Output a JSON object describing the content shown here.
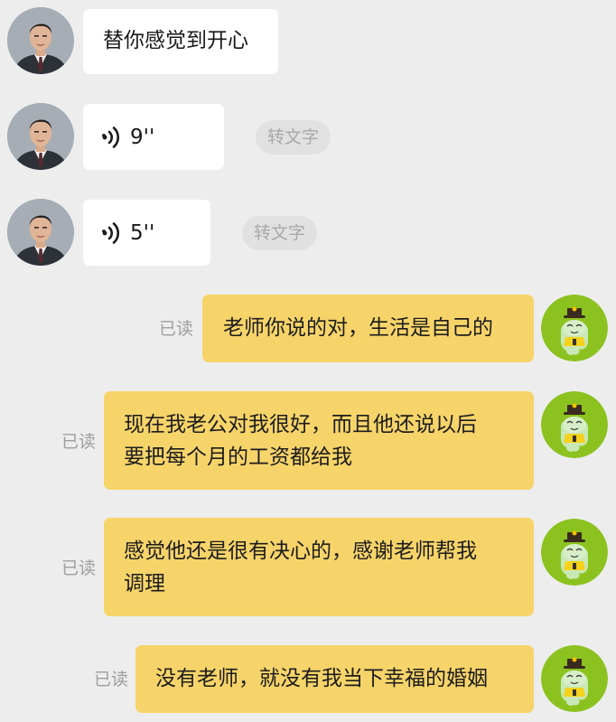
{
  "messages": [
    {
      "from": "them",
      "type": "text",
      "text": "替你感觉到开心"
    },
    {
      "from": "them",
      "type": "voice",
      "duration": "9''",
      "transcribe_label": "转文字"
    },
    {
      "from": "them",
      "type": "voice",
      "duration": "5''",
      "transcribe_label": "转文字"
    },
    {
      "from": "me",
      "type": "text",
      "status": "已读",
      "lines": [
        "老师你说的对，生活是自己的"
      ]
    },
    {
      "from": "me",
      "type": "text",
      "status": "已读",
      "lines": [
        "现在我老公对我很好，而且他还说以后",
        "要把每个月的工资都给我"
      ]
    },
    {
      "from": "me",
      "type": "text",
      "status": "已读",
      "lines": [
        "感觉他还是很有决心的，感谢老师帮我",
        "调理"
      ]
    },
    {
      "from": "me",
      "type": "text",
      "status": "已读",
      "lines": [
        "没有老师，就没有我当下幸福的婚姻"
      ]
    }
  ],
  "colors": {
    "background": "#ededed",
    "incoming_bubble": "#ffffff",
    "outgoing_bubble": "#f7d46a",
    "read_text": "#9e9e9e",
    "transcribe_pill": "#e1e1e1"
  },
  "icons": {
    "voice": "voice-wave-icon",
    "contact_avatar": "man-in-suit-avatar",
    "user_avatar": "green-cartoon-ghost-avatar"
  }
}
